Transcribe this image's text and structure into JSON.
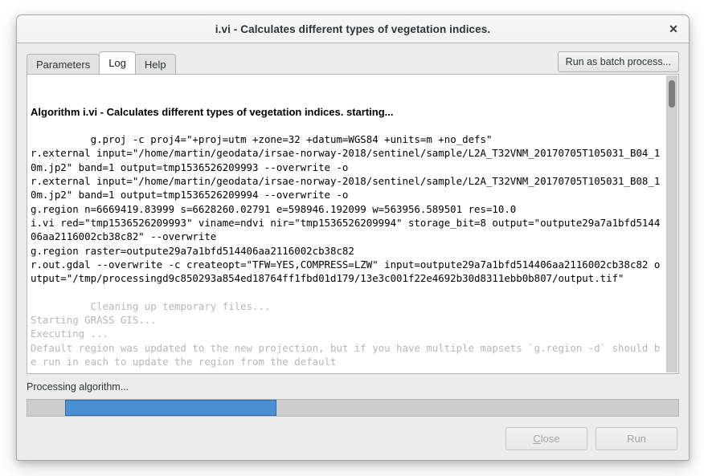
{
  "window": {
    "title": "i.vi - Calculates different types of vegetation indices.",
    "close_icon": "close-icon"
  },
  "tabs": [
    {
      "label": "Parameters",
      "selected": false
    },
    {
      "label": "Log",
      "selected": true
    },
    {
      "label": "Help",
      "selected": false
    }
  ],
  "toolbar": {
    "batch_label": "Run as batch process..."
  },
  "log": {
    "header": "Algorithm i.vi - Calculates different types of vegetation indices. starting...",
    "body": "g.proj -c proj4=\"+proj=utm +zone=32 +datum=WGS84 +units=m +no_defs\"\nr.external input=\"/home/martin/geodata/irsae-norway-2018/sentinel/sample/L2A_T32VNM_20170705T105031_B04_10m.jp2\" band=1 output=tmp1536526209993 --overwrite -o\nr.external input=\"/home/martin/geodata/irsae-norway-2018/sentinel/sample/L2A_T32VNM_20170705T105031_B08_10m.jp2\" band=1 output=tmp1536526209994 --overwrite -o\ng.region n=6669419.83999 s=6628260.02791 e=598946.192099 w=563956.589501 res=10.0\ni.vi red=\"tmp1536526209993\" viname=ndvi nir=\"tmp1536526209994\" storage_bit=8 output=\"outpute29a7a1bfd514406aa2116002cb38c82\" --overwrite\ng.region raster=outpute29a7a1bfd514406aa2116002cb38c82\nr.out.gdal --overwrite -c createopt=\"TFW=YES,COMPRESS=LZW\" input=outpute29a7a1bfd514406aa2116002cb38c82 output=\"/tmp/processingd9c850293a854ed18764ff1fbd01d179/13e3c001f22e4692b30d8311ebb0b807/output.tif\"",
    "dim_body": "Cleaning up temporary files...\nStarting GRASS GIS...\nExecuting ...\nDefault region was updated to the new projection, but if you have multiple mapsets `g.region -d` should be run in each to update the region from the default"
  },
  "status": {
    "message": "Processing algorithm...",
    "progress_percent": 33,
    "progress_color": "#4a8fd4",
    "indeterminate": true
  },
  "buttons": {
    "close_label": "Close",
    "close_mnemonic": "C",
    "close_rest": "lose",
    "close_enabled": false,
    "run_label": "Run",
    "run_enabled": false
  }
}
